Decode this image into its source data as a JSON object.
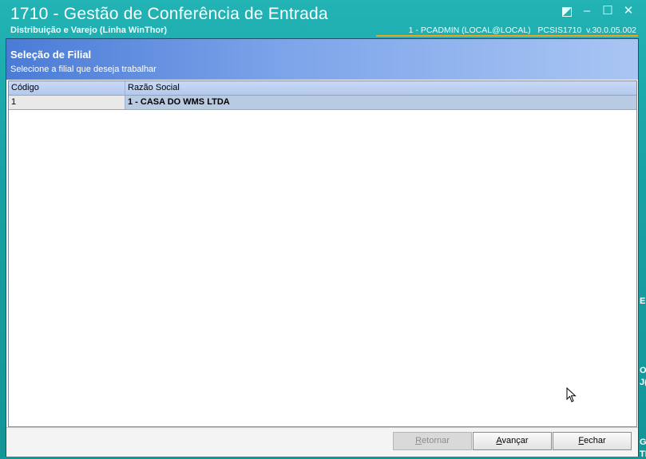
{
  "window": {
    "title": "1710 - Gestão de Conferência de Entrada",
    "subtitle": "Distribuição e Varejo (Linha WinThor)",
    "status": "1 - PCADMIN (LOCAL@LOCAL)   PCSIS1710  v.30.0.05.002"
  },
  "edge_text": [
    "E",
    "O",
    "J(",
    "GE",
    "TE"
  ],
  "dialog": {
    "title": "Seleção de Filial",
    "subtitle": "Selecione a filial que deseja trabalhar",
    "columns": [
      "Código",
      "Razão Social"
    ],
    "rows": [
      {
        "code": "1",
        "name": "1 - CASA DO WMS LTDA"
      }
    ],
    "buttons": {
      "back": {
        "first": "R",
        "rest": "etornar"
      },
      "next": {
        "first": "A",
        "rest": "vançar"
      },
      "close": {
        "first": "F",
        "rest": "echar"
      }
    }
  },
  "colors": {
    "frame": "#1aa3a6",
    "accent": "#f0a51e",
    "header_blue": "#4a7bd6",
    "selected_row": "#b9cbe3"
  }
}
